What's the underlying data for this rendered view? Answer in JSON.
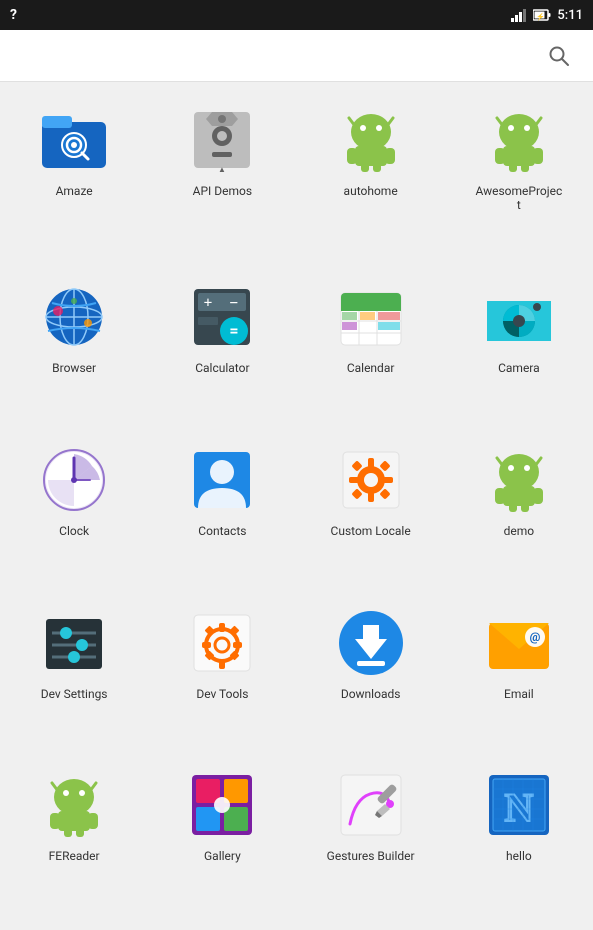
{
  "statusBar": {
    "question": "?",
    "time": "5:11",
    "batteryIcon": "🔋",
    "signalIcon": "📶"
  },
  "searchBar": {
    "placeholder": "Search"
  },
  "apps": [
    {
      "id": "amaze",
      "label": "Amaze",
      "color": "#2196F3",
      "iconType": "folder-search"
    },
    {
      "id": "api-demos",
      "label": "API Demos",
      "color": "#9E9E9E",
      "iconType": "android-gear"
    },
    {
      "id": "autohome",
      "label": "autohome",
      "color": "#8BC34A",
      "iconType": "android-green"
    },
    {
      "id": "awesome-project",
      "label": "AwesomeProject",
      "color": "#8BC34A",
      "iconType": "android-green2"
    },
    {
      "id": "browser",
      "label": "Browser",
      "color": "#1565C0",
      "iconType": "globe"
    },
    {
      "id": "calculator",
      "label": "Calculator",
      "color": "#263238",
      "iconType": "calculator"
    },
    {
      "id": "calendar",
      "label": "Calendar",
      "color": "#4CAF50",
      "iconType": "calendar"
    },
    {
      "id": "camera",
      "label": "Camera",
      "color": "#26C6DA",
      "iconType": "camera"
    },
    {
      "id": "clock",
      "label": "Clock",
      "color": "#7E57C2",
      "iconType": "clock"
    },
    {
      "id": "contacts",
      "label": "Contacts",
      "color": "#1E88E5",
      "iconType": "contacts"
    },
    {
      "id": "custom-locale",
      "label": "Custom Locale",
      "color": "#9E9E9E",
      "iconType": "custom-locale"
    },
    {
      "id": "demo",
      "label": "demo",
      "color": "#8BC34A",
      "iconType": "android-green3"
    },
    {
      "id": "dev-settings",
      "label": "Dev Settings",
      "color": "#37474F",
      "iconType": "dev-settings"
    },
    {
      "id": "dev-tools",
      "label": "Dev Tools",
      "color": "#9E9E9E",
      "iconType": "dev-tools"
    },
    {
      "id": "downloads",
      "label": "Downloads",
      "color": "#1E88E5",
      "iconType": "downloads"
    },
    {
      "id": "email",
      "label": "Email",
      "color": "#FFA000",
      "iconType": "email"
    },
    {
      "id": "fereader",
      "label": "FEReader",
      "color": "#8BC34A",
      "iconType": "android-green4"
    },
    {
      "id": "gallery",
      "label": "Gallery",
      "color": "#7B1FA2",
      "iconType": "gallery"
    },
    {
      "id": "gestures-builder",
      "label": "Gestures Builder",
      "color": "#BDBDBD",
      "iconType": "gestures"
    },
    {
      "id": "hello",
      "label": "hello",
      "color": "#1565C0",
      "iconType": "hello"
    }
  ]
}
